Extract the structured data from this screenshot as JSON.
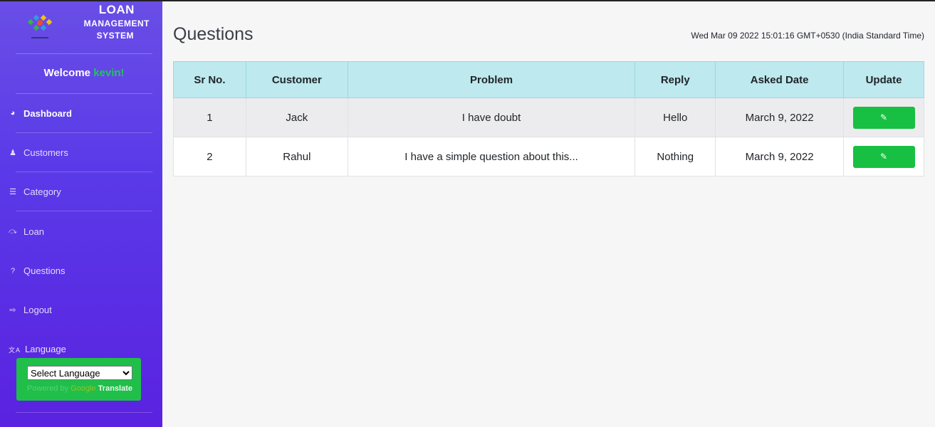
{
  "sidebar": {
    "brand": {
      "line1": "LOAN",
      "line2": "MANAGEMENT",
      "line3": "SYSTEM",
      "logo_icon": "puzzle-logo-icon"
    },
    "welcome_prefix": "Welcome ",
    "username": "kevin!",
    "nav": [
      {
        "label": "Dashboard",
        "icon": "dashboard-gauge-icon",
        "glyph": "◕",
        "active": true
      },
      {
        "label": "Customers",
        "icon": "user-icon",
        "glyph": "♟",
        "active": false
      },
      {
        "label": "Category",
        "icon": "list-icon",
        "glyph": "☰",
        "active": false
      },
      {
        "label": "Loan",
        "icon": "hand-money-icon",
        "glyph": "⤼",
        "active": false
      },
      {
        "label": "Questions",
        "icon": "question-icon",
        "glyph": "?",
        "active": false
      },
      {
        "label": "Logout",
        "icon": "logout-icon",
        "glyph": "⇨",
        "active": false
      }
    ],
    "language_label": "Language",
    "language_icon_glyph": "文A",
    "select_value": "Select Language",
    "powered_by": "Powered by ",
    "google": "Google",
    "translate": " Translate"
  },
  "main": {
    "title": "Questions",
    "datetime": "Wed Mar 09 2022 15:01:16 GMT+0530 (India Standard Time)",
    "table": {
      "headers": [
        "Sr No.",
        "Customer",
        "Problem",
        "Reply",
        "Asked Date",
        "Update"
      ],
      "rows": [
        {
          "sr": "1",
          "customer": "Jack",
          "problem": "I have doubt",
          "reply": "Hello",
          "date": "March 9, 2022"
        },
        {
          "sr": "2",
          "customer": "Rahul",
          "problem": "I have a simple question about this...",
          "reply": "Nothing",
          "date": "March 9, 2022"
        }
      ],
      "update_glyph": "✎"
    }
  },
  "colors": {
    "sidebar_top": "#6a4ee6",
    "sidebar_bottom": "#5a22e0",
    "accent_green": "#17c042",
    "table_header": "#bde9ef"
  }
}
